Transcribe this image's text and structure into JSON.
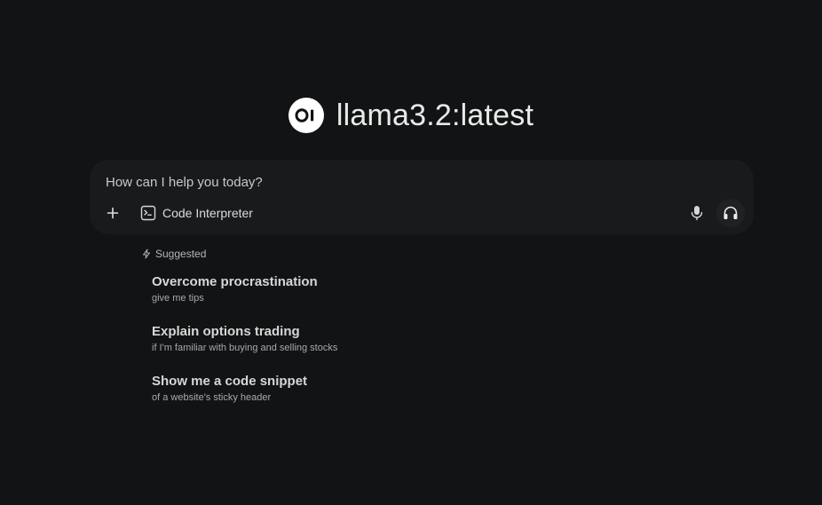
{
  "header": {
    "logo_text": "OI",
    "model_name": "llama3.2:latest"
  },
  "composer": {
    "placeholder": "How can I help you today?",
    "add_icon": "plus-icon",
    "tool_label": "Code Interpreter",
    "tool_icon": "terminal-icon",
    "mic_icon": "microphone-icon",
    "voice_icon": "headphones-icon"
  },
  "suggestions": {
    "heading": "Suggested",
    "heading_icon": "lightning-icon",
    "items": [
      {
        "title": "Overcome procrastination",
        "subtitle": "give me tips"
      },
      {
        "title": "Explain options trading",
        "subtitle": "if I'm familiar with buying and selling stocks"
      },
      {
        "title": "Show me a code snippet",
        "subtitle": "of a website's sticky header"
      }
    ]
  },
  "colors": {
    "background": "#121314",
    "composer_bg": "#181a1c",
    "text": "#e6e6e6",
    "muted": "#a9a9a9"
  }
}
